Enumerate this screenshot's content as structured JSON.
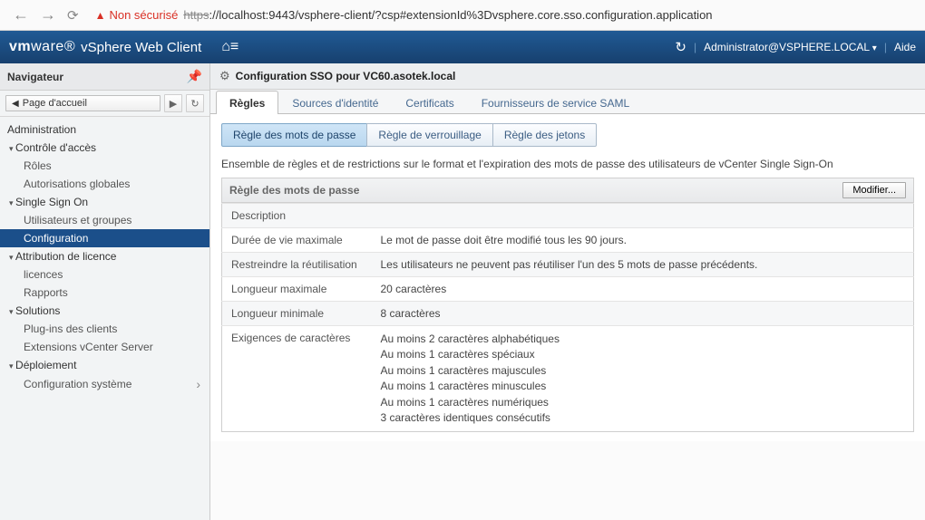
{
  "browser": {
    "insecure_label": "Non sécurisé",
    "url_scheme": "https",
    "url_rest": "://localhost:9443/vsphere-client/?csp#extensionId%3Dvsphere.core.sso.configuration.application"
  },
  "header": {
    "logo_prefix": "vm",
    "logo_suffix": "ware",
    "product": "vSphere Web Client",
    "user": "Administrator@VSPHERE.LOCAL",
    "help": "Aide"
  },
  "navigator": {
    "title": "Navigateur",
    "breadcrumb": "Page d'accueil",
    "root": "Administration",
    "sections": [
      {
        "label": "Contrôle d'accès",
        "children": [
          "Rôles",
          "Autorisations globales"
        ]
      },
      {
        "label": "Single Sign On",
        "children": [
          "Utilisateurs et groupes",
          "Configuration"
        ],
        "selected_child": 1
      },
      {
        "label": "Attribution de licence",
        "children": [
          "licences",
          "Rapports"
        ]
      },
      {
        "label": "Solutions",
        "children": [
          "Plug-ins des clients",
          "Extensions vCenter Server"
        ]
      },
      {
        "label": "Déploiement",
        "children": [
          "Configuration système"
        ]
      }
    ]
  },
  "content": {
    "title": "Configuration SSO pour VC60.asotek.local",
    "tabs": [
      "Règles",
      "Sources d'identité",
      "Certificats",
      "Fournisseurs de service SAML"
    ],
    "active_tab": 0,
    "subtabs": [
      "Règle des mots de passe",
      "Règle de verrouillage",
      "Règle des jetons"
    ],
    "active_subtab": 0,
    "intro": "Ensemble de règles et de restrictions sur le format et l'expiration des mots de passe des utilisateurs de vCenter Single Sign-On",
    "section_label": "Règle des mots de passe",
    "edit_button": "Modifier...",
    "rows": [
      {
        "k": "Description",
        "v": ""
      },
      {
        "k": "Durée de vie maximale",
        "v": "Le mot de passe doit être modifié tous les 90 jours."
      },
      {
        "k": "Restreindre la réutilisation",
        "v": "Les utilisateurs ne peuvent pas réutiliser l'un des 5 mots de passe précédents."
      },
      {
        "k": "Longueur maximale",
        "v": "20 caractères"
      },
      {
        "k": "Longueur minimale",
        "v": "8 caractères"
      }
    ],
    "char_req_label": "Exigences de caractères",
    "char_req_values": [
      "Au moins 2 caractères alphabétiques",
      "Au moins 1 caractères spéciaux",
      "Au moins 1 caractères majuscules",
      "Au moins 1 caractères minuscules",
      "Au moins 1 caractères numériques",
      "3 caractères identiques consécutifs"
    ]
  }
}
